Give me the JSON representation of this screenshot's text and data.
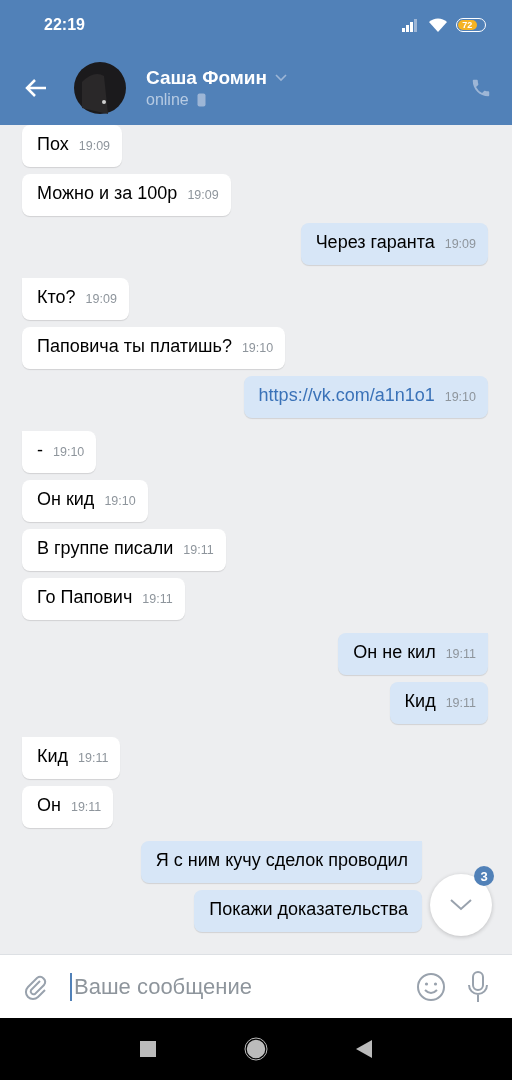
{
  "status_bar": {
    "time": "22:19",
    "battery": "72"
  },
  "header": {
    "name": "Саша Фомин",
    "status": "online"
  },
  "messages": [
    {
      "kind": "text",
      "outgoing": false,
      "tail": false,
      "text": "Пох",
      "time": "19:09"
    },
    {
      "kind": "text",
      "outgoing": false,
      "tail": false,
      "text": "Можно и за 100р",
      "time": "19:09"
    },
    {
      "kind": "text",
      "outgoing": true,
      "tail": false,
      "text": "Через гаранта",
      "time": "19:09"
    },
    {
      "kind": "text",
      "outgoing": false,
      "tail": true,
      "text": "Кто?",
      "time": "19:09"
    },
    {
      "kind": "text",
      "outgoing": false,
      "tail": false,
      "text": "Паповича ты платишь?",
      "time": "19:10"
    },
    {
      "kind": "link",
      "outgoing": true,
      "tail": false,
      "text": "https://vk.com/a1n1o1",
      "time": "19:10"
    },
    {
      "kind": "text",
      "outgoing": false,
      "tail": true,
      "text": "-",
      "time": "19:10"
    },
    {
      "kind": "text",
      "outgoing": false,
      "tail": false,
      "text": "Он кид",
      "time": "19:10"
    },
    {
      "kind": "text",
      "outgoing": false,
      "tail": false,
      "text": "В группе писали",
      "time": "19:11"
    },
    {
      "kind": "text",
      "outgoing": false,
      "tail": false,
      "text": "Го Папович",
      "time": "19:11"
    },
    {
      "kind": "text",
      "outgoing": true,
      "tail": true,
      "text": "Он не кил",
      "time": "19:11"
    },
    {
      "kind": "text",
      "outgoing": true,
      "tail": false,
      "text": "Кид",
      "time": "19:11"
    },
    {
      "kind": "text",
      "outgoing": false,
      "tail": true,
      "text": "Кид",
      "time": "19:11"
    },
    {
      "kind": "text",
      "outgoing": false,
      "tail": false,
      "text": "Он",
      "time": "19:11"
    },
    {
      "kind": "text",
      "outgoing": true,
      "tail": true,
      "text": "Я с ним кучу сделок проводил"
    },
    {
      "kind": "text",
      "outgoing": true,
      "tail": false,
      "text": "Покажи доказательства"
    }
  ],
  "scroll_button": {
    "badge": "3"
  },
  "composer": {
    "placeholder": "Ваше сообщение"
  }
}
